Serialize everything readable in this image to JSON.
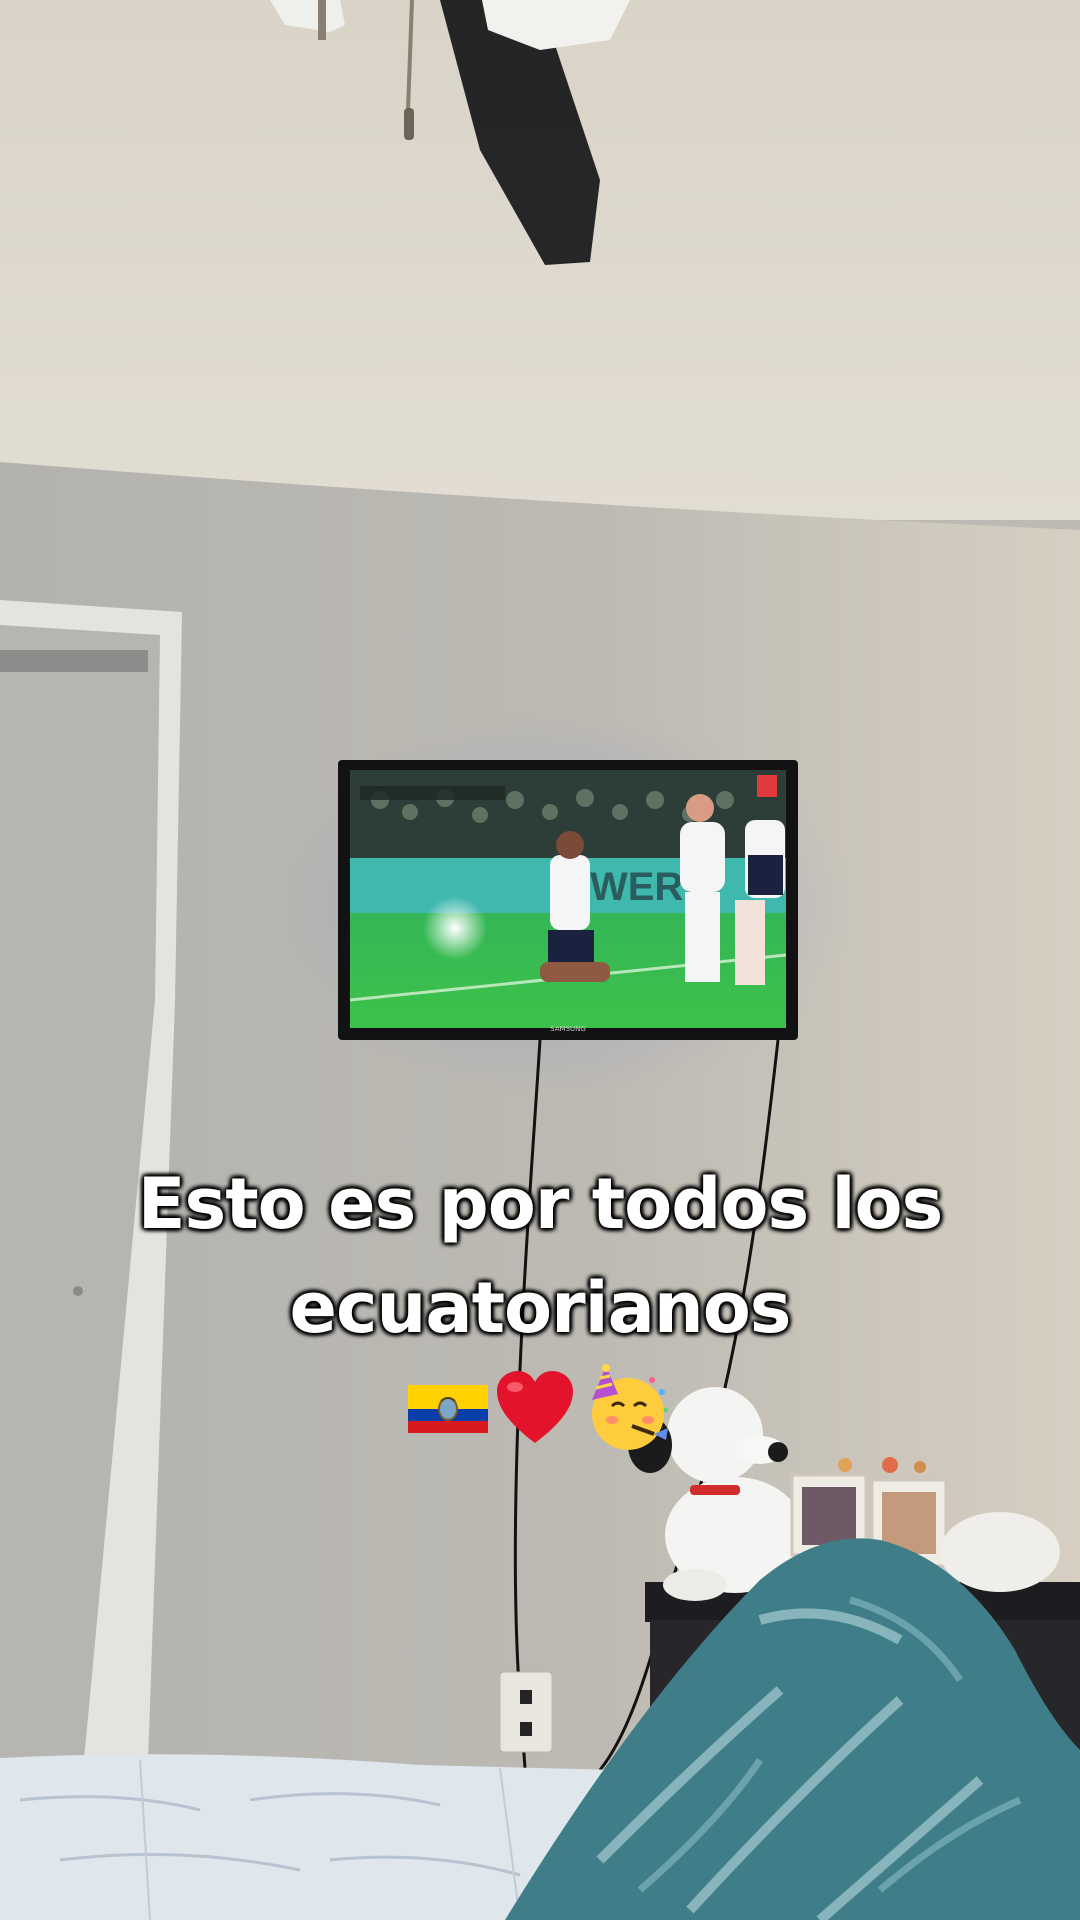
{
  "caption": {
    "line1": "Esto es por todos los",
    "line2": "ecuatorianos"
  },
  "emojis": [
    "ecuador-flag",
    "red-heart",
    "partying-face"
  ],
  "tv": {
    "brand": "SAMSUNG",
    "banner_text": "WERA"
  },
  "colors": {
    "ceiling": "#dcd6cb",
    "wall": "#bcb9b2",
    "pitch": "#35b84d",
    "blanket": "#3f7e89"
  }
}
